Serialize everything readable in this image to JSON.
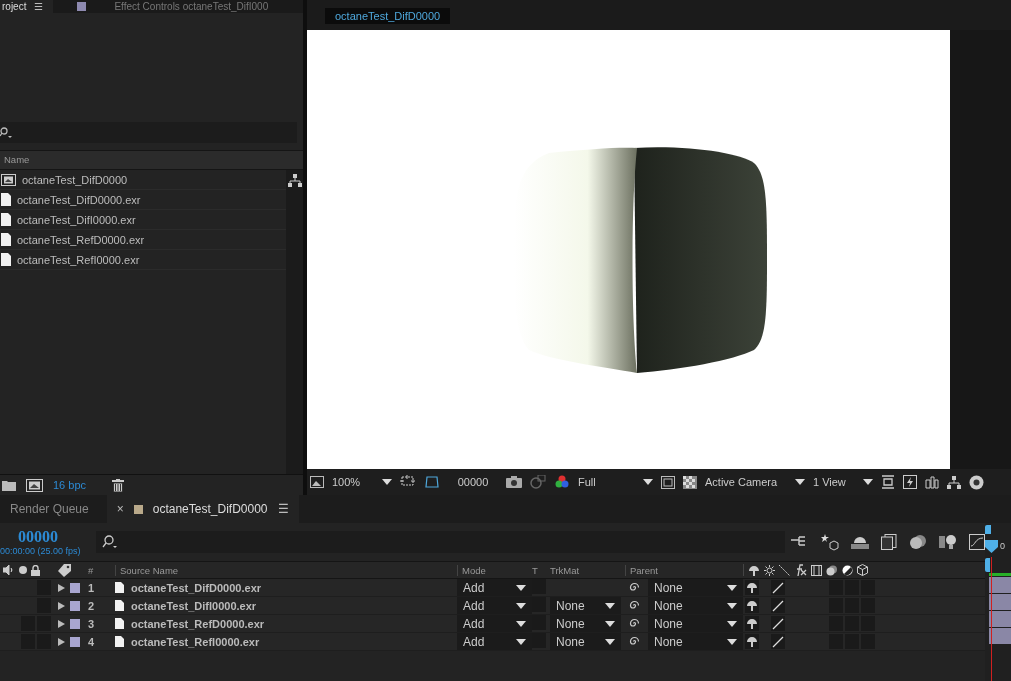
{
  "project_panel": {
    "tabs": [
      {
        "label": "roject",
        "selected": true,
        "menu_glyph": "☰"
      },
      {
        "label": "Effect Controls octaneTest_DifI000",
        "selected": false
      }
    ],
    "column_header": "Name",
    "items": [
      {
        "name": "octaneTest_DifD0000",
        "kind": "composition"
      },
      {
        "name": "octaneTest_DifD0000.exr",
        "kind": "file"
      },
      {
        "name": "octaneTest_DifI0000.exr",
        "kind": "file"
      },
      {
        "name": "octaneTest_RefD0000.exr",
        "kind": "file"
      },
      {
        "name": "octaneTest_RefI0000.exr",
        "kind": "file"
      }
    ],
    "bit_depth": "16 bpc"
  },
  "viewer": {
    "tab": "octaneTest_DifD0000",
    "zoom": "100%",
    "frame": "00000",
    "resolution": "Full",
    "camera": "Active Camera",
    "views": "1 View"
  },
  "timeline": {
    "tabs": [
      {
        "label": "Render Queue",
        "selected": false
      },
      {
        "label": "octaneTest_DifD0000",
        "selected": true,
        "close_glyph": "×",
        "menu_glyph": "☰",
        "color": "#b9a98a"
      }
    ],
    "timecode": "00000",
    "timecode_detail": "00:00:00 (25.00 fps)",
    "columns": {
      "number": "#",
      "source_name": "Source Name",
      "mode": "Mode",
      "t": "T",
      "trkmat": "TrkMat",
      "parent": "Parent"
    },
    "layers": [
      {
        "number": "1",
        "name": "octaneTest_DifD0000.exr",
        "color": "#a9a6d0",
        "mode": "Add",
        "parent": "None"
      },
      {
        "number": "2",
        "name": "octaneTest_DifI0000.exr",
        "color": "#a9a6d0",
        "mode": "Add",
        "trkmat": "None",
        "parent": "None"
      },
      {
        "number": "3",
        "name": "octaneTest_RefD0000.exr",
        "color": "#a9a6d0",
        "mode": "Add",
        "trkmat": "None",
        "parent": "None"
      },
      {
        "number": "4",
        "name": "octaneTest_RefI0000.exr",
        "color": "#a9a6d0",
        "mode": "Add",
        "trkmat": "None",
        "parent": "None"
      }
    ],
    "ruler_label": "0"
  }
}
